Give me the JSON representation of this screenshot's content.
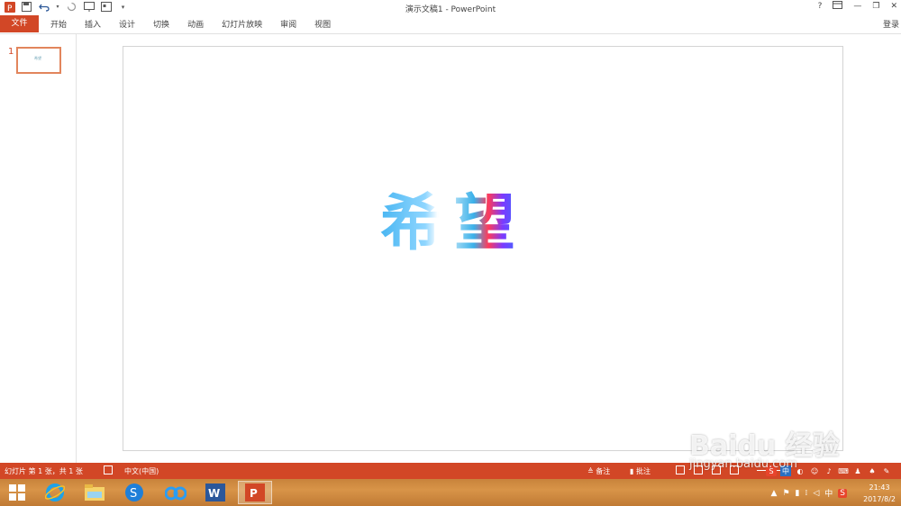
{
  "window": {
    "title": "演示文稿1 - PowerPoint",
    "help": "?",
    "controls": {
      "minimize": "—",
      "restore": "❐",
      "close": "✕"
    }
  },
  "qat": {
    "icons": [
      "powerpoint-logo-icon",
      "save-icon",
      "undo-icon",
      "redo-icon",
      "presentation-icon",
      "picture-icon",
      "customize-icon"
    ]
  },
  "ribbon": {
    "file_tab": "文件",
    "tabs": [
      "开始",
      "插入",
      "设计",
      "切换",
      "动画",
      "幻灯片放映",
      "审阅",
      "视图"
    ],
    "login": "登录"
  },
  "thumbnails": {
    "slide_number": "1",
    "thumb_text": "希望"
  },
  "slide": {
    "wordart": "希望"
  },
  "statusbar": {
    "slide_info": "幻灯片 第 1 张，共 1 张",
    "language": "中文(中国)",
    "notes": "≜ 备注",
    "comments": "▮ 批注"
  },
  "ime": {
    "mode": "中"
  },
  "taskbar": {
    "apps": [
      "windows-start-icon",
      "ie-icon",
      "file-explorer-icon",
      "sogou-browser-icon",
      "baidu-cloud-icon",
      "word-icon",
      "powerpoint-icon"
    ],
    "tray_lang": "中",
    "clock_time": "21:43",
    "clock_date": "2017/8/2"
  },
  "watermark": {
    "main": "Baidu 经验",
    "sub": "jingyan.baidu.com"
  },
  "colors": {
    "accent": "#d24726",
    "taskbar": "#c8833b"
  }
}
